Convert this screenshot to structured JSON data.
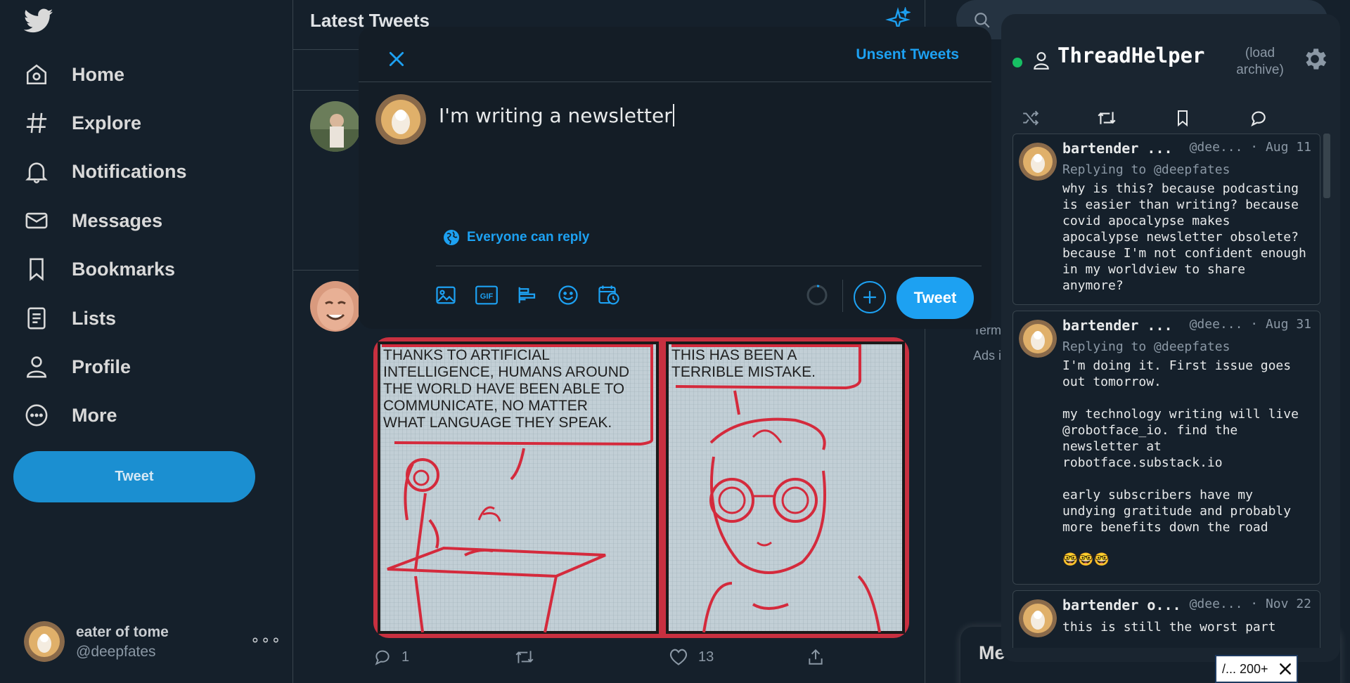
{
  "nav": {
    "items": [
      {
        "label": "Home",
        "icon": "home-icon"
      },
      {
        "label": "Explore",
        "icon": "hashtag-icon"
      },
      {
        "label": "Notifications",
        "icon": "bell-icon"
      },
      {
        "label": "Messages",
        "icon": "envelope-icon"
      },
      {
        "label": "Bookmarks",
        "icon": "bookmark-icon"
      },
      {
        "label": "Lists",
        "icon": "list-icon"
      },
      {
        "label": "Profile",
        "icon": "person-icon"
      },
      {
        "label": "More",
        "icon": "more-circle-icon"
      }
    ],
    "tweet_button": "Tweet",
    "account": {
      "name": "eater of tome",
      "handle": "@deepfates",
      "more": "∘∘∘"
    }
  },
  "timeline": {
    "title": "Latest Tweets",
    "comic": {
      "panel1_caption": "THANKS TO ARTIFICIAL INTELLIGENCE, HUMANS AROUND THE WORLD HAVE BEEN ABLE TO COMMUNICATE, NO MATTER WHAT LANGUAGE THEY SPEAK.",
      "panel2_caption": "THIS HAS BEEN A TERRIBLE MISTAKE."
    },
    "actions": {
      "replies": "1",
      "likes": "13"
    }
  },
  "rightcol": {
    "footer_terms": "Term",
    "footer_ads": "Ads i",
    "messages_label": "Mes"
  },
  "compose": {
    "unsent_label": "Unsent Tweets",
    "text": "I'm writing a newsletter",
    "reply_setting": "Everyone can reply",
    "tweet_button": "Tweet",
    "gif_label": "GIF"
  },
  "threadhelper": {
    "title": "ThreadHelper",
    "load_archive": "(load archive)",
    "tweets": [
      {
        "name": "bartender ...",
        "handle": "@dee...",
        "date": "Aug 11",
        "replying_to": "Replying to @deepfates",
        "text": "why is this? because podcasting is easier than writing? because covid apocalypse makes apocalypse newsletter obsolete? because I'm not confident enough in my worldview to share anymore?"
      },
      {
        "name": "bartender ...",
        "handle": "@dee...",
        "date": "Aug 31",
        "replying_to": "Replying to @deepfates",
        "text": "I'm doing it. First issue goes out tomorrow.\n\nmy technology writing will live @robotface_io. find the newsletter at robotface.substack.io\n\nearly subscribers have my undying gratitude and probably more benefits down the road\n\n🤓🤓🤓"
      },
      {
        "name": "bartender o...",
        "handle": "@dee...",
        "date": "Nov 22",
        "replying_to": "",
        "text": "this is still the worst part"
      }
    ]
  },
  "corner_badge": {
    "text": "/... 200+"
  },
  "colors": {
    "background": "#15202b",
    "accent": "#1da1f2",
    "nav_tweet_button": "#1b8fd1",
    "status_online": "#17bf63",
    "comic_ink": "#d42a3c"
  }
}
